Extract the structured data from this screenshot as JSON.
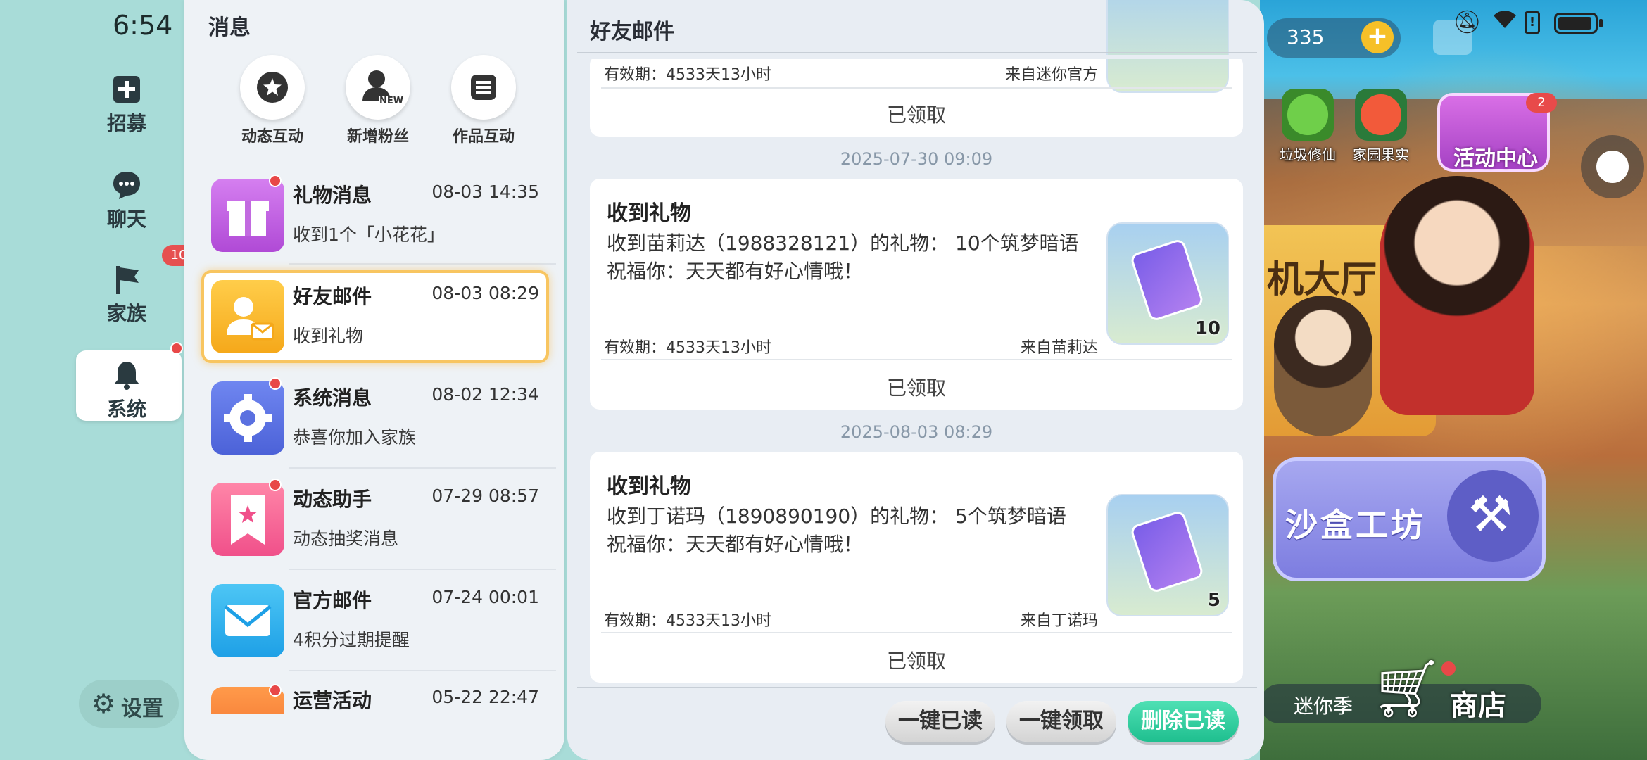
{
  "status_bar": {
    "time": "6:54"
  },
  "sidebar": {
    "items": [
      {
        "label": "招募"
      },
      {
        "label": "聊天"
      },
      {
        "label": "家族",
        "badge": "10"
      },
      {
        "label": "系统"
      }
    ],
    "settings_label": "设置"
  },
  "list_panel": {
    "title": "消息",
    "quick_actions": [
      {
        "label": "动态互动"
      },
      {
        "label": "新增粉丝",
        "icon_tag": "NEW"
      },
      {
        "label": "作品互动"
      }
    ],
    "messages": [
      {
        "title": "礼物消息",
        "time": "08-03 14:35",
        "subtitle": "收到1个「小花花」"
      },
      {
        "title": "好友邮件",
        "time": "08-03 08:29",
        "subtitle": "收到礼物"
      },
      {
        "title": "系统消息",
        "time": "08-02 12:34",
        "subtitle": "恭喜你加入家族"
      },
      {
        "title": "动态助手",
        "time": "07-29 08:57",
        "subtitle": "动态抽奖消息"
      },
      {
        "title": "官方邮件",
        "time": "07-24 00:01",
        "subtitle": "4积分过期提醒"
      },
      {
        "title": "运营活动",
        "time": "05-22 22:47",
        "subtitle": ""
      }
    ]
  },
  "detail_panel": {
    "title": "好友邮件",
    "cards": [
      {
        "validity": "有效期：4533天13小时",
        "from": "来自迷你官方",
        "status": "已领取"
      },
      {
        "date": "2025-07-30 09:09",
        "title": "收到礼物",
        "body_line1": "收到苗莉达（1988328121）的礼物： 10个筑梦暗语",
        "body_line2": "祝福你：天天都有好心情哦！",
        "validity": "有效期：4533天13小时",
        "from": "来自苗莉达",
        "status": "已领取",
        "quantity": "10"
      },
      {
        "date": "2025-08-03 08:29",
        "title": "收到礼物",
        "body_line1": "收到丁诺玛（1890890190）的礼物： 5个筑梦暗语",
        "body_line2": "祝福你：天天都有好心情哦！",
        "validity": "有效期：4533天13小时",
        "from": "来自丁诺玛",
        "status": "已领取",
        "quantity": "5"
      }
    ],
    "buttons": {
      "mark_read": "一键已读",
      "claim_all": "一键领取",
      "delete_read": "删除已读"
    }
  },
  "game": {
    "coins": "335",
    "icons": [
      {
        "label": "垃圾修仙"
      },
      {
        "label": "家园果实"
      }
    ],
    "activity_center": {
      "label": "活动中心",
      "badge": "2"
    },
    "lobby_text": "机大厅",
    "sandbox_label": "沙盒工坊",
    "season_label": "迷你季",
    "shop_label": "商店"
  }
}
